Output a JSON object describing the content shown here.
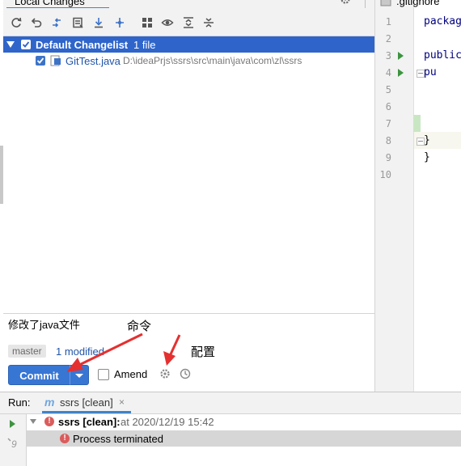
{
  "changes_tab": {
    "title": "Local Changes"
  },
  "toolbar": {
    "icons": [
      "refresh-icon",
      "rollback-icon",
      "diff-icon",
      "shelve-icon",
      "update-icon",
      "tree-icon",
      "group-icon",
      "preview-icon",
      "expand-all-icon",
      "collapse-all-icon"
    ]
  },
  "tree": {
    "changelist": {
      "name": "Default Changelist",
      "count": "1 file"
    },
    "files": [
      {
        "name": "GitTest.java",
        "path": "D:\\ideaPrjs\\ssrs\\src\\main\\java\\com\\zl\\ssrs"
      }
    ]
  },
  "commit": {
    "message": "修改了java文件",
    "branch": "master",
    "modified": "1 modified",
    "commit_label": "Commit",
    "amend_label": "Amend"
  },
  "annotations": {
    "command": "命令",
    "config": "配置"
  },
  "editor": {
    "tab_title": ".gitignore",
    "line_numbers": [
      "1",
      "2",
      "3",
      "4",
      "5",
      "6",
      "7",
      "8",
      "9",
      "10"
    ],
    "code_lines": [
      "packag",
      "",
      "public",
      "    pu",
      "",
      "",
      "",
      "    }",
      "}",
      ""
    ]
  },
  "run": {
    "label": "Run:",
    "tab_name": "ssrs [clean]",
    "close_glyph": "×",
    "entry_name": "ssrs [clean]:",
    "entry_time": "at 2020/12/19 15:42",
    "entry_message": "Process terminated"
  },
  "colors": {
    "selection": "#2f65ca",
    "commit_button": "#3876d4",
    "error": "#db5c5c",
    "run_green": "#3d9440",
    "arrow_red": "#e53030"
  }
}
